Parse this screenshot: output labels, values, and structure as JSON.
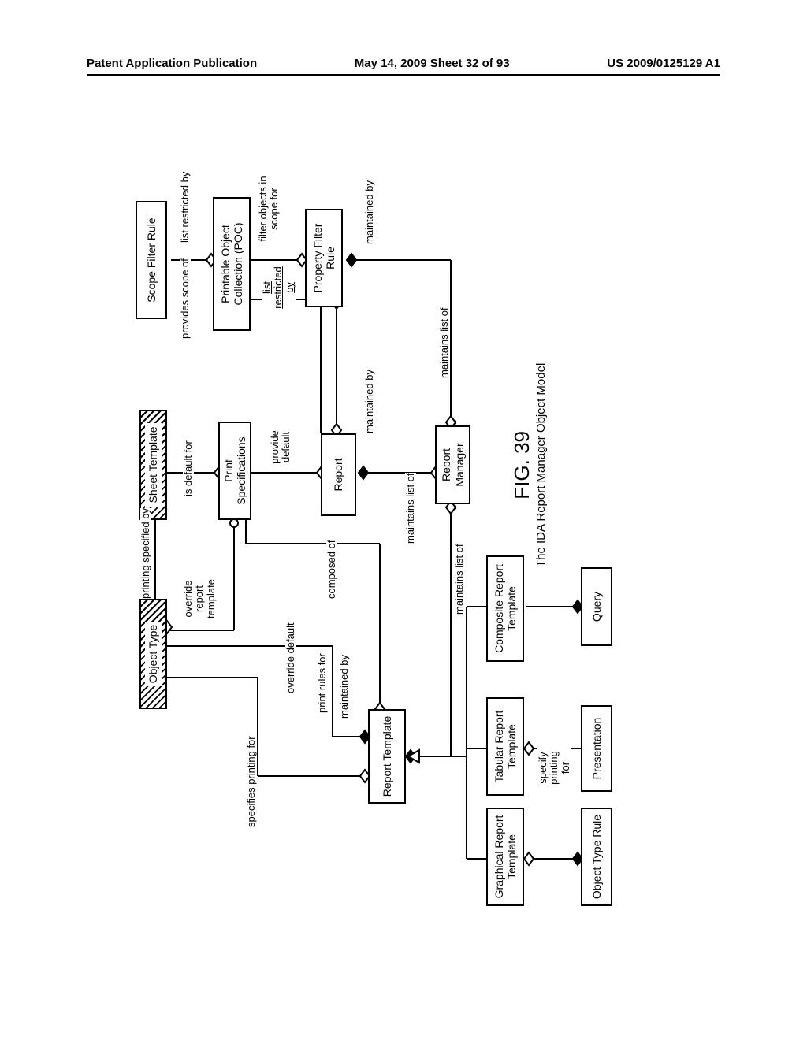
{
  "header": {
    "left": "Patent Application Publication",
    "center": "May 14, 2009  Sheet 32 of 93",
    "right": "US 2009/0125129 A1"
  },
  "figure": {
    "number": "FIG. 39",
    "caption": "The IDA Report Manager Object Model"
  },
  "boxes": {
    "sheet_template": "Sheet Template",
    "object_type": "Object Type",
    "print_specs": "Print Specifications",
    "scope_filter_rule": "Scope Filter Rule",
    "poc": "Printable Object Collection (POC)",
    "property_filter_rule": "Property Filter Rule",
    "report": "Report",
    "report_template": "Report Template",
    "report_manager": "Report Manager",
    "graphical_rt": "Graphical Report Template",
    "tabular_rt": "Tabular Report Template",
    "composite_rt": "Composite Report Template",
    "object_type_rule": "Object Type Rule",
    "presentation": "Presentation",
    "query": "Query"
  },
  "labels": {
    "is_default_for": "is default for",
    "printing_specified_by": "printing specified by",
    "override_report_template": "override report template",
    "provides_scope_of": "provides scope of",
    "list_restricted_by": "list restricted by",
    "list_restricted_by2": "list restricted by",
    "filter_objects_in_scope_for": "filter objects in scope for",
    "provide_default": "provide default",
    "override_default": "override default",
    "composed_of": "composed of",
    "specifies_printing_for": "specifies printing for",
    "print_rules_for": "print rules for",
    "maintained_by": "maintained by",
    "maintained_by2": "maintained by",
    "maintained_by3": "maintained by",
    "maintains_list_of": "maintains list of",
    "maintains_list_of2": "maintains list of",
    "maintains_list_of3": "maintains list of",
    "specify_printing_for": "specify printing for"
  },
  "chart_data": {
    "type": "diagram",
    "title": "The IDA Report Manager Object Model",
    "nodes": [
      "Sheet Template",
      "Object Type",
      "Print Specifications",
      "Scope Filter Rule",
      "Printable Object Collection (POC)",
      "Property Filter Rule",
      "Report",
      "Report Template",
      "Report Manager",
      "Graphical Report Template",
      "Tabular Report Template",
      "Composite Report Template",
      "Object Type Rule",
      "Presentation",
      "Query"
    ],
    "edges": [
      {
        "from": "Sheet Template",
        "to": "Print Specifications",
        "label": "is default for"
      },
      {
        "from": "Object Type",
        "to": "Sheet Template",
        "label": "printing specified by"
      },
      {
        "from": "Object Type",
        "to": "Print Specifications",
        "label": "override report template"
      },
      {
        "from": "Scope Filter Rule",
        "to": "Printable Object Collection (POC)",
        "label": "provides scope of"
      },
      {
        "from": "Printable Object Collection (POC)",
        "to": "Scope Filter Rule",
        "label": "list restricted by"
      },
      {
        "from": "Printable Object Collection (POC)",
        "to": "Property Filter Rule",
        "label": "list restricted by"
      },
      {
        "from": "Property Filter Rule",
        "to": "Report",
        "label": "filter objects in scope for"
      },
      {
        "from": "Print Specifications",
        "to": "Report",
        "label": "provide default"
      },
      {
        "from": "Report Template",
        "to": "Print Specifications",
        "label": "override default"
      },
      {
        "from": "Report",
        "to": "Printable Object Collection (POC)",
        "label": "composed of"
      },
      {
        "from": "Report Template",
        "to": "Object Type",
        "label": "specifies printing for"
      },
      {
        "from": "Report Template",
        "to": "Object Type",
        "label": "print rules for"
      },
      {
        "from": "Report",
        "to": "Report Manager",
        "label": "maintained by"
      },
      {
        "from": "Report Template",
        "to": "Report Manager",
        "label": "maintained by"
      },
      {
        "from": "Property Filter Rule",
        "to": "Report Manager",
        "label": "maintained by"
      },
      {
        "from": "Report Manager",
        "to": "Report",
        "label": "maintains list of"
      },
      {
        "from": "Report Manager",
        "to": "Report Template",
        "label": "maintains list of"
      },
      {
        "from": "Report Manager",
        "to": "Property Filter Rule",
        "label": "maintains list of"
      },
      {
        "from": "Tabular Report Template",
        "to": "Presentation",
        "label": "specify printing for"
      },
      {
        "from": "Report Template",
        "to": "Graphical Report Template",
        "label": ""
      },
      {
        "from": "Report Template",
        "to": "Tabular Report Template",
        "label": ""
      },
      {
        "from": "Report Template",
        "to": "Composite Report Template",
        "label": ""
      },
      {
        "from": "Graphical Report Template",
        "to": "Object Type Rule",
        "label": ""
      },
      {
        "from": "Composite Report Template",
        "to": "Query",
        "label": ""
      }
    ]
  }
}
